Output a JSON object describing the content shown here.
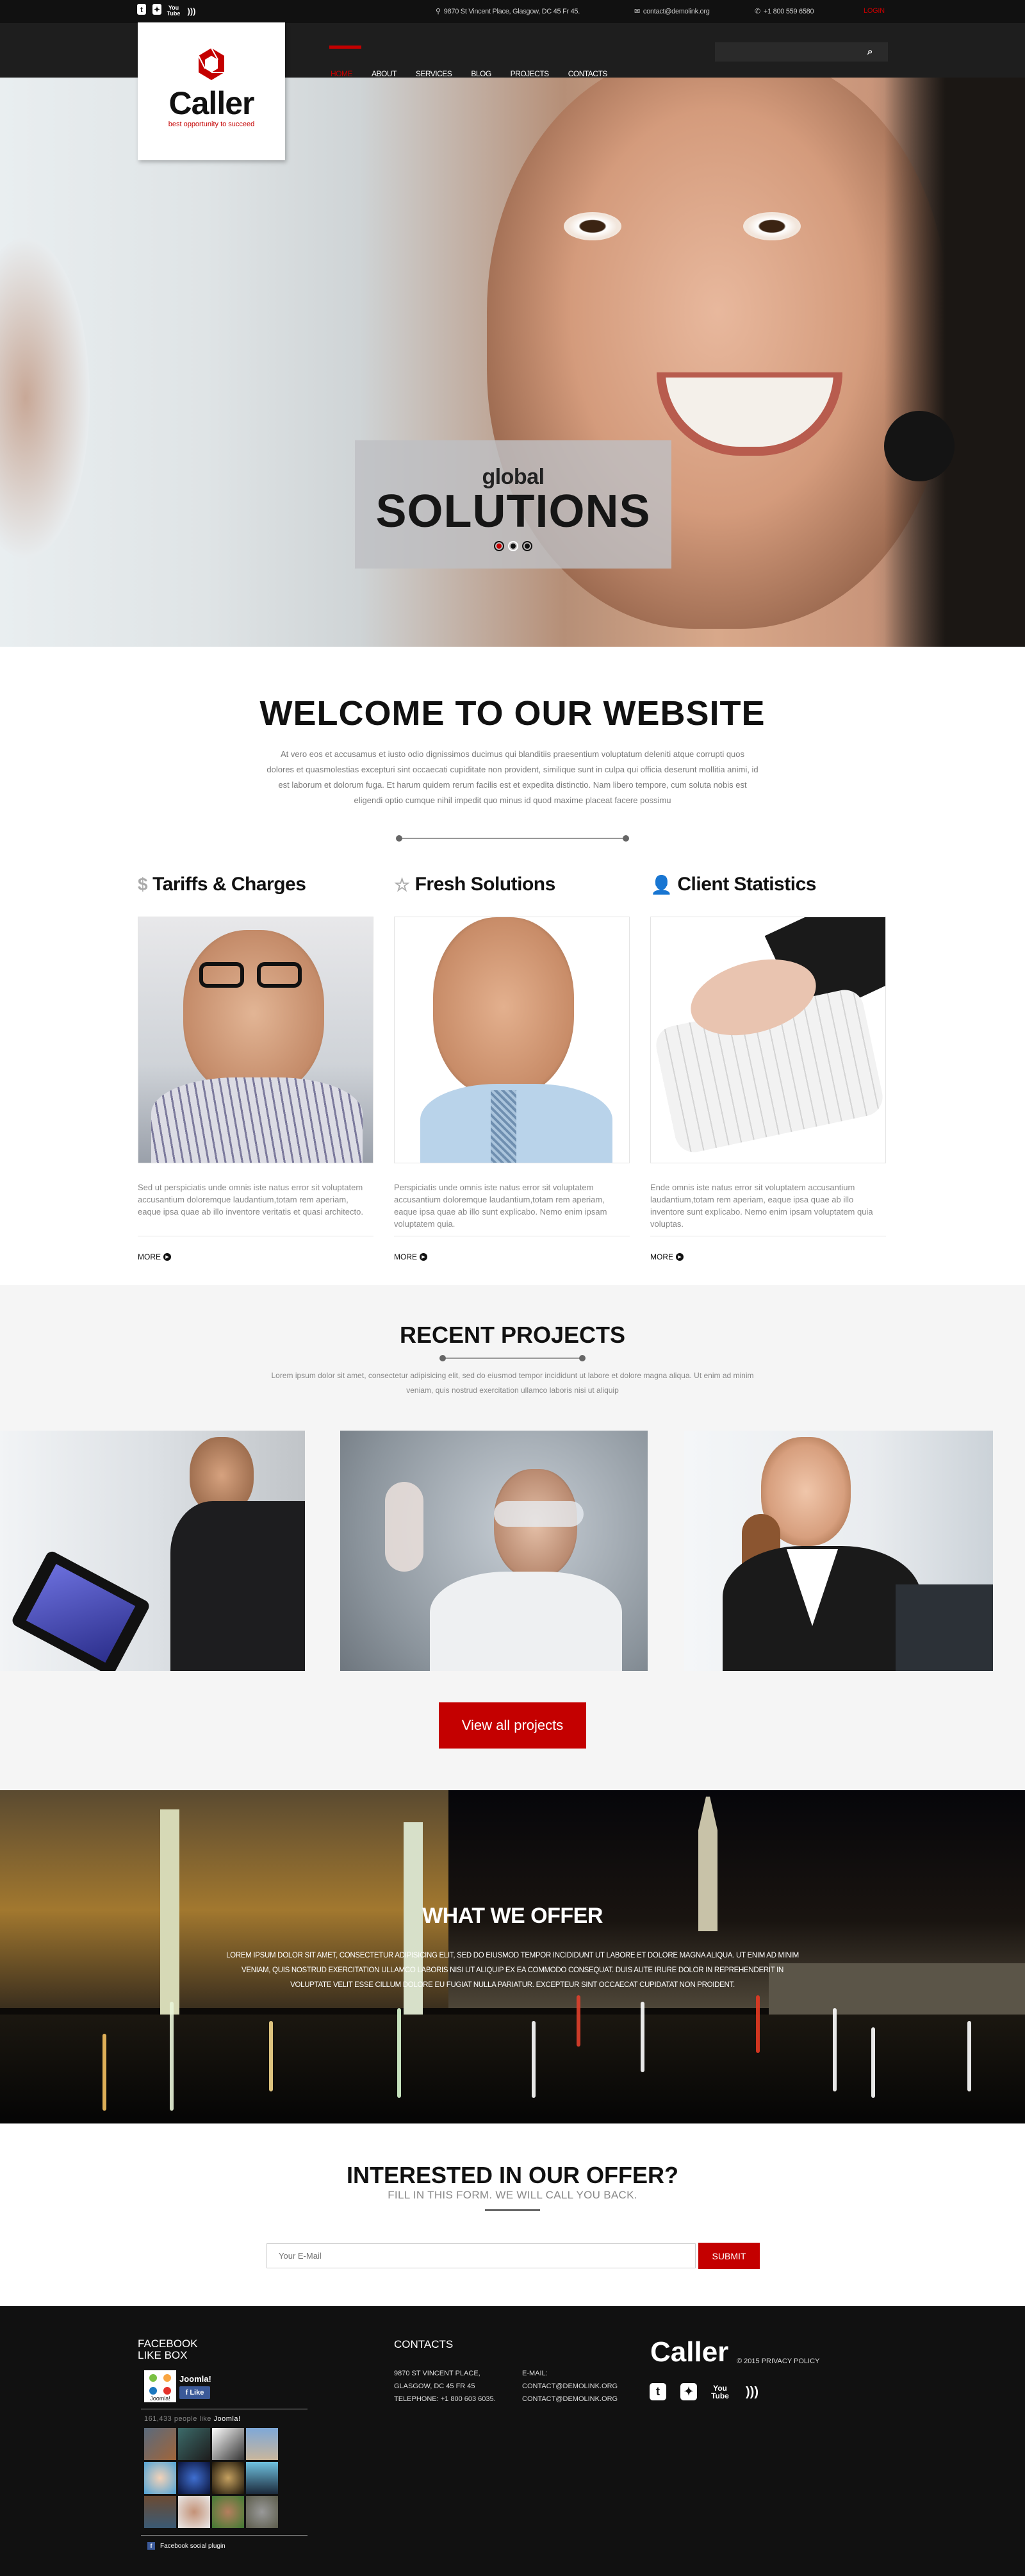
{
  "topbar": {
    "social": [
      {
        "icon": "tumblr-icon",
        "glyph": "t"
      },
      {
        "icon": "twitter-icon",
        "glyph": "🐦"
      },
      {
        "icon": "youtube-icon",
        "glyph": "▶"
      },
      {
        "icon": "rss-icon",
        "glyph": "◔"
      }
    ],
    "address": "9870 St Vincent Place, Glasgow, DC 45 Fr 45.",
    "email": "contact@demolink.org",
    "phone": "+1 800 559 6580",
    "login": "LOGIN"
  },
  "logo": {
    "name": "Caller",
    "tagline": "best opportunity to succeed"
  },
  "nav": {
    "items": [
      "HOME",
      "ABOUT",
      "SERVICES",
      "BLOG",
      "PROJECTS",
      "CONTACTS"
    ],
    "active": "HOME",
    "search_placeholder": "",
    "search_icon": "🔍"
  },
  "hero": {
    "caption_small": "global",
    "caption_big": "SOLUTIONS",
    "slides": 3,
    "active_slide": 1
  },
  "welcome": {
    "title": "WELCOME TO OUR WEBSITE",
    "text": "At vero eos et accusamus et iusto odio dignissimos ducimus qui blanditiis praesentium voluptatum deleniti atque corrupti quos dolores et quasmolestias excepturi sint occaecati cupiditate non provident, similique sunt in culpa qui officia deserunt mollitia animi, id est laborum et dolorum fuga. Et harum quidem rerum facilis est et expedita distinctio. Nam libero tempore, cum soluta nobis est eligendi optio cumque nihil impedit quo minus id quod maxime placeat facere possimu"
  },
  "features": [
    {
      "icon": "money-bag-icon",
      "glyph": "💰",
      "title": "Tariffs & Charges",
      "text": "Sed ut perspiciatis unde omnis iste natus error sit voluptatem accusantium doloremque laudantium,totam rem aperiam, eaque ipsa quae ab illo inventore veritatis et quasi architecto.",
      "more": "MORE"
    },
    {
      "icon": "star-icon",
      "glyph": "☆",
      "title": "Fresh Solutions",
      "text": "Perspiciatis unde omnis iste natus error sit voluptatem accusantium doloremque laudantium,totam rem aperiam, eaque ipsa quae ab illo sunt explicabo. Nemo enim ipsam voluptatem quia.",
      "more": "MORE"
    },
    {
      "icon": "user-icon",
      "glyph": "👤",
      "title": "Client Statistics",
      "text": "Ende omnis iste natus error sit voluptatem accusantium laudantium,totam rem aperiam, eaque ipsa quae ab illo inventore sunt explicabo. Nemo enim ipsam voluptatem quia voluptas.",
      "more": "MORE"
    }
  ],
  "recent": {
    "title": "RECENT PROJECTS",
    "text": "Lorem ipsum dolor sit amet, consectetur adipisicing elit, sed do eiusmod tempor incididunt ut labore et dolore magna aliqua. Ut enim ad minim veniam, quis nostrud exercitation ullamco laboris nisi ut aliquip",
    "button": "View all projects"
  },
  "offer": {
    "title": "WHAT WE OFFER",
    "text": "LOREM IPSUM DOLOR SIT AMET, CONSECTETUR ADIPISICING ELIT, SED DO EIUSMOD TEMPOR INCIDIDUNT UT LABORE ET DOLORE MAGNA ALIQUA. UT ENIM AD MINIM VENIAM, QUIS NOSTRUD EXERCITATION ULLAMCO LABORIS NISI UT ALIQUIP EX EA COMMODO CONSEQUAT. DUIS AUTE IRURE DOLOR IN REPREHENDERIT IN VOLUPTATE VELIT ESSE CILLUM DOLORE EU FUGIAT NULLA PARIATUR. EXCEPTEUR SINT OCCAECAT CUPIDATAT NON PROIDENT."
  },
  "interested": {
    "title": "INTERESTED IN OUR OFFER?",
    "subtitle": "FILL IN THIS FORM. WE WILL CALL YOU BACK.",
    "email_placeholder": "Your E-Mail",
    "submit": "SUBMIT"
  },
  "footer": {
    "fb_title_1": "FACEBOOK",
    "fb_title_2": "LIKE BOX",
    "fb_page": "Joomla!",
    "fb_like": "Like",
    "fb_count": "161,433 people like",
    "fb_count_page": "Joomla!",
    "fb_plugin": "Facebook social plugin",
    "contacts_title": "CONTACTS",
    "address_lines": [
      "9870 ST VINCENT PLACE,",
      "GLASGOW, DC 45 FR 45",
      "TELEPHONE: +1 800 603 6035."
    ],
    "email_lines": [
      "E-MAIL:",
      "CONTACT@DEMOLINK.ORG",
      "CONTACT@DEMOLINK.ORG"
    ],
    "logo": "Caller",
    "copyright": "© 2015 PRIVACY POLICY"
  },
  "colors": {
    "accent": "#c40000",
    "dark": "#111111",
    "nav": "#1e1e1e",
    "light_bg": "#f5f5f5"
  }
}
